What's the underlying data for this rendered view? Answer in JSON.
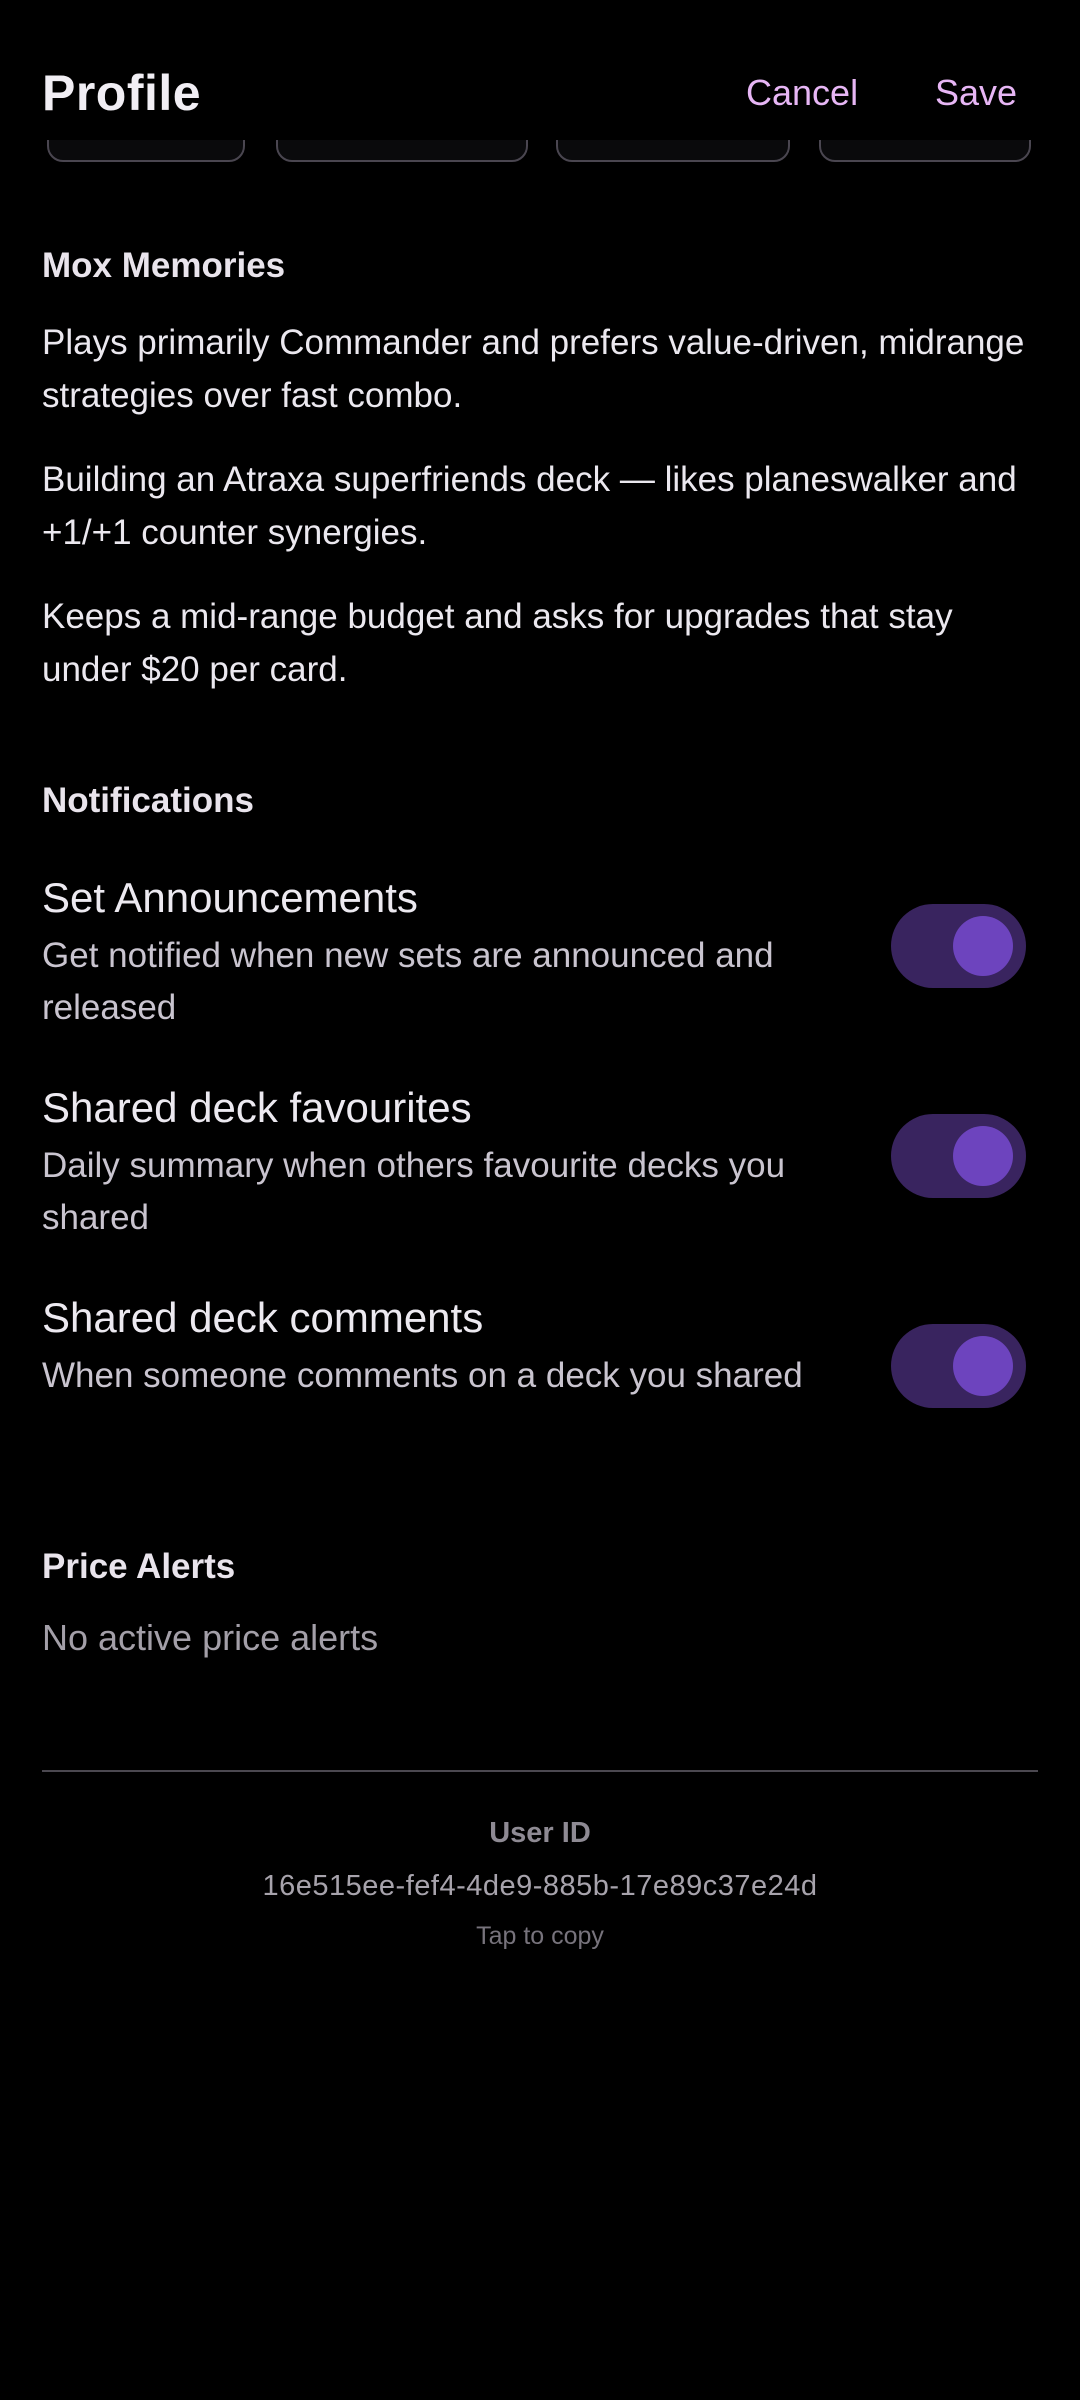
{
  "header": {
    "title": "Profile",
    "cancel_label": "Cancel",
    "save_label": "Save"
  },
  "memories": {
    "title": "Mox Memories",
    "items": [
      "Plays primarily Commander and prefers value-driven, midrange strategies over fast combo.",
      "Building an Atraxa superfriends deck — likes planeswalker and +1/+1 counter synergies.",
      "Keeps a mid-range budget and asks for upgrades that stay under $20 per card."
    ]
  },
  "notifications": {
    "title": "Notifications",
    "items": [
      {
        "title": "Set Announcements",
        "description": "Get notified when new sets are announced and released",
        "enabled": true
      },
      {
        "title": "Shared deck favourites",
        "description": "Daily summary when others favourite decks you shared",
        "enabled": true
      },
      {
        "title": "Shared deck comments",
        "description": "When someone comments on a deck you shared",
        "enabled": true
      }
    ]
  },
  "price_alerts": {
    "title": "Price Alerts",
    "empty_text": "No active price alerts"
  },
  "user_id": {
    "label": "User ID",
    "value": "16e515ee-fef4-4de9-885b-17e89c37e24d",
    "hint": "Tap to copy"
  },
  "colors": {
    "background": "#000000",
    "accent_text": "#e7b6f5",
    "toggle_track": "#39245f",
    "toggle_knob": "#6d44be"
  }
}
